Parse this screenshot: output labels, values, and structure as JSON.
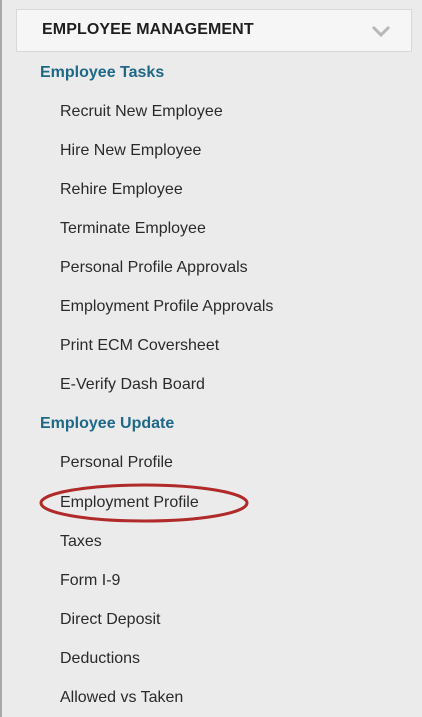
{
  "menu": {
    "title": "EMPLOYEE MANAGEMENT",
    "sections": [
      {
        "title": "Employee Tasks",
        "items": [
          "Recruit New Employee",
          "Hire New Employee",
          "Rehire Employee",
          "Terminate Employee",
          "Personal Profile Approvals",
          "Employment Profile Approvals",
          "Print ECM Coversheet",
          "E-Verify Dash Board"
        ]
      },
      {
        "title": "Employee Update",
        "items": [
          "Personal Profile",
          "Employment Profile",
          "Taxes",
          "Form I-9",
          "Direct Deposit",
          "Deductions",
          "Allowed vs Taken"
        ]
      }
    ],
    "highlighted_item": "Employment Profile",
    "highlight_color": "#b02a2a",
    "section_color": "#1d6987"
  }
}
